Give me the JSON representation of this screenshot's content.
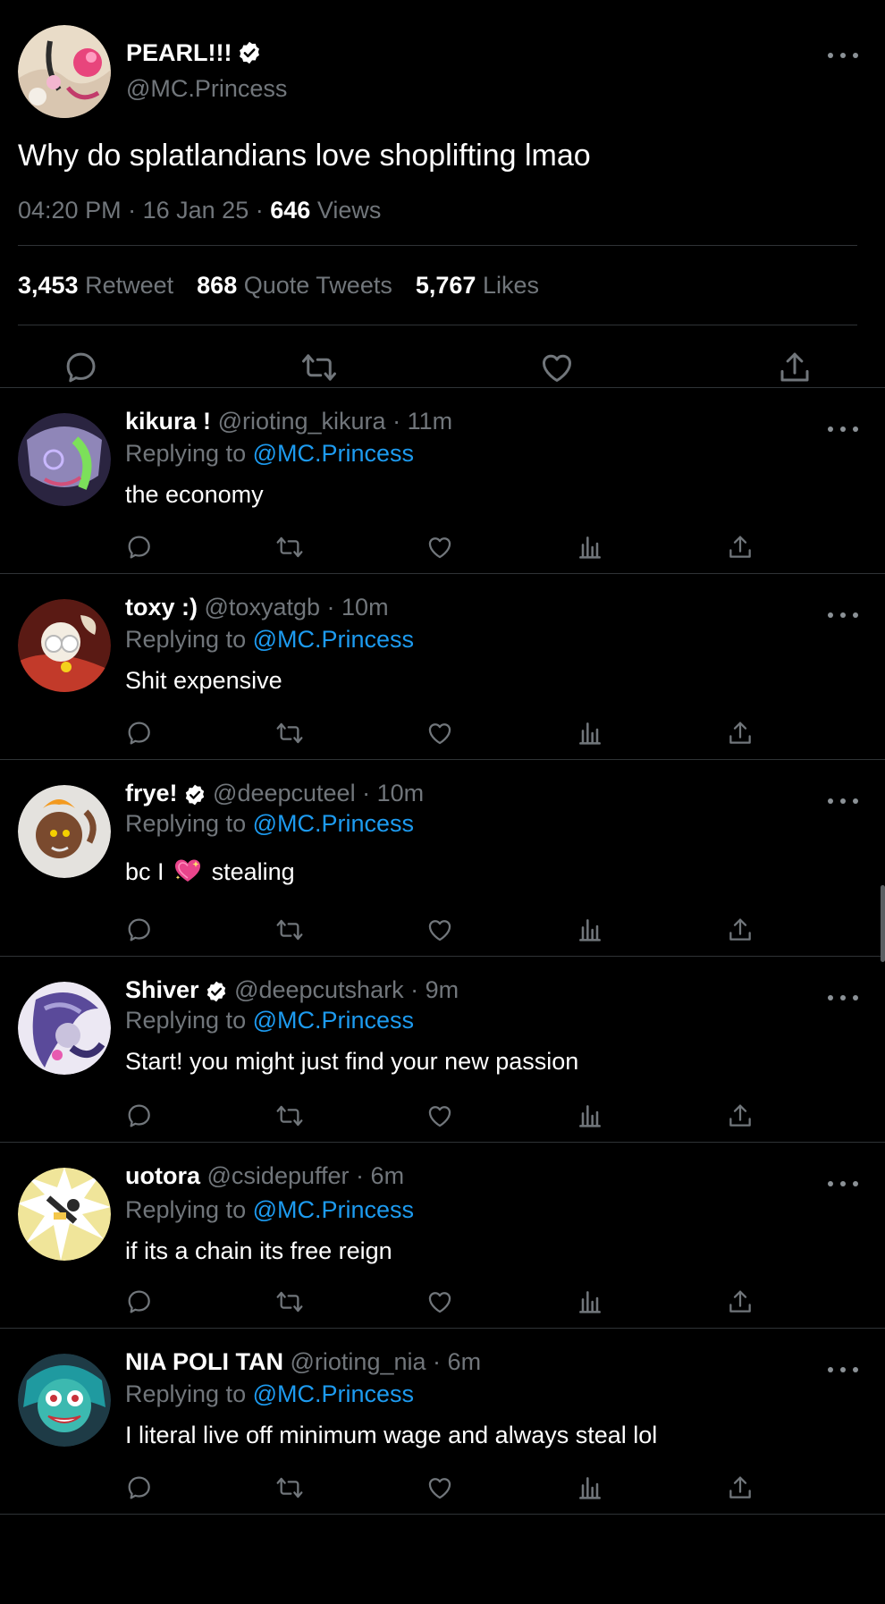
{
  "main_tweet": {
    "display_name": "PEARL!!!",
    "handle": "@MC.Princess",
    "verified": true,
    "text": "Why do splatlandians love shoplifting lmao",
    "time": "04:20 PM",
    "date": "16 Jan 25",
    "views_count": "646",
    "views_label": "Views",
    "meta_sep": "·",
    "stats": {
      "retweets_count": "3,453",
      "retweets_label": "Retweet",
      "quotes_count": "868",
      "quotes_label": "Quote Tweets",
      "likes_count": "5,767",
      "likes_label": "Likes"
    },
    "actions": [
      "reply-icon",
      "retweet-icon",
      "like-icon",
      "share-icon"
    ]
  },
  "replies": [
    {
      "display_name": "kikura !",
      "handle": "@rioting_kikura",
      "sep": "·",
      "time": "11m",
      "verified": false,
      "replying_label": "Replying to",
      "replying_to": "@MC.Princess",
      "text": "the economy"
    },
    {
      "display_name": "toxy :)",
      "handle": "@toxyatgb",
      "sep": "·",
      "time": "10m",
      "verified": false,
      "replying_label": "Replying to",
      "replying_to": "@MC.Princess",
      "text": "Shit expensive"
    },
    {
      "display_name": "frye!",
      "handle": "@deepcuteel",
      "sep": "·",
      "time": "10m",
      "verified": true,
      "replying_label": "Replying to",
      "replying_to": "@MC.Princess",
      "text_before": "bc I",
      "text_after": "stealing"
    },
    {
      "display_name": "Shiver",
      "handle": "@deepcutshark",
      "sep": "·",
      "time": "9m",
      "verified": true,
      "replying_label": "Replying to",
      "replying_to": "@MC.Princess",
      "text": "Start! you might just find your new passion"
    },
    {
      "display_name": "uotora",
      "handle": "@csidepuffer",
      "sep": "·",
      "time": "6m",
      "verified": false,
      "replying_label": "Replying to",
      "replying_to": "@MC.Princess",
      "text": "if its a chain its free reign"
    },
    {
      "display_name": "NIA POLI TAN",
      "handle": "@rioting_nia",
      "sep": "·",
      "time": "6m",
      "verified": false,
      "replying_label": "Replying to",
      "replying_to": "@MC.Princess",
      "text": "I literal live off minimum wage and always steal lol"
    }
  ],
  "reply_actions": [
    "reply-icon",
    "retweet-icon",
    "like-icon",
    "views-icon",
    "share-icon"
  ],
  "colors": {
    "background": "#000000",
    "text": "#ffffff",
    "muted": "#71767b",
    "link": "#1d9bf0",
    "divider": "#2f3336"
  }
}
